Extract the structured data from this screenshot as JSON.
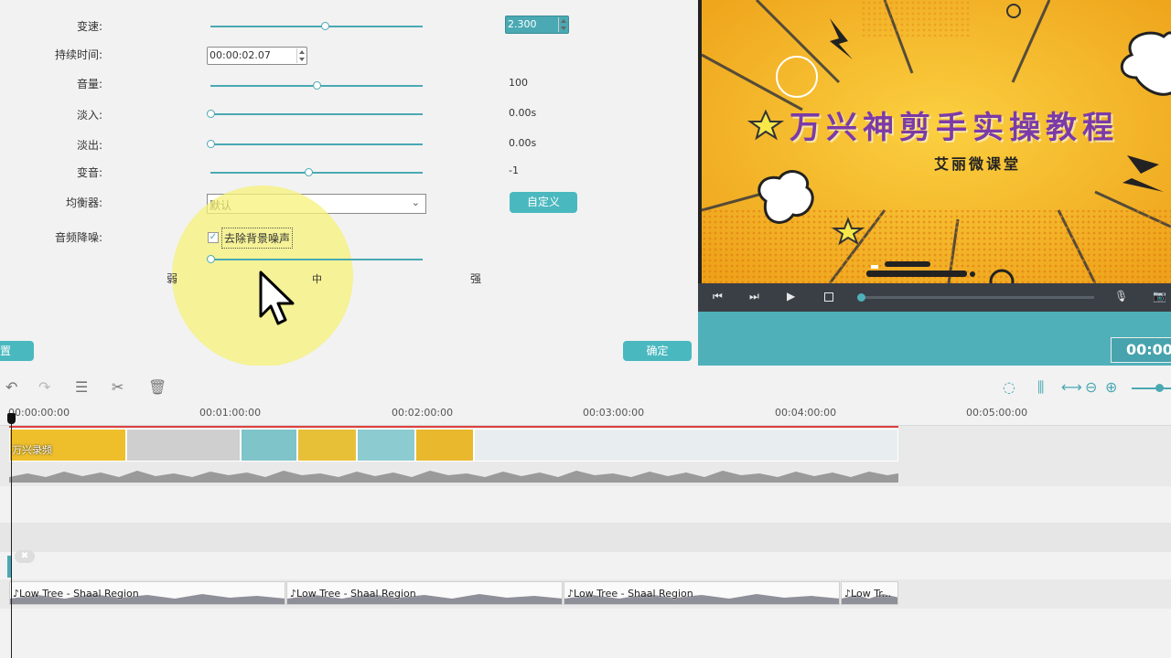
{
  "settings": {
    "speed_label": "变速:",
    "speed_value": "2.300",
    "speed_level": 0.54,
    "duration_label": "持续时间:",
    "duration_value": "00:00:02.07",
    "volume_label": "音量:",
    "volume_value": "100",
    "volume_level": 0.5,
    "fadein_label": "淡入:",
    "fadein_value": "0.00s",
    "fadein_level": 0.0,
    "fadeout_label": "淡出:",
    "fadeout_value": "0.00s",
    "fadeout_level": 0.0,
    "pitch_label": "变音:",
    "pitch_value": "-1",
    "pitch_level": 0.46,
    "equalizer_label": "均衡器:",
    "equalizer_selected": "默认",
    "custom_button": "自定义",
    "denoise_label": "音频降噪:",
    "denoise_checkbox": "去除背景噪声",
    "denoise_checked": true,
    "denoise_level": 0.0,
    "weak_label": "弱",
    "medium_label": "中",
    "strong_label": "强",
    "reset_button": "置",
    "ok_button": "确定"
  },
  "preview": {
    "title": "万兴神剪手实操教程",
    "subtitle": "艾丽微课堂",
    "timecode": "00:00",
    "controls": [
      "prev-frame-icon",
      "next-frame-icon",
      "play-icon",
      "stop-icon",
      "microphone-icon",
      "camera-icon"
    ]
  },
  "timeline": {
    "tools": [
      "undo-icon",
      "redo-icon",
      "adjust-icon",
      "scissors-icon",
      "trash-icon",
      "render-icon",
      "audio-mixer-icon",
      "fit-icon",
      "zoom-out-icon",
      "zoom-in-icon"
    ],
    "ruler_ticks": [
      "00:00:00:00",
      "00:01:00:00",
      "00:02:00:00",
      "00:03:00:00",
      "00:04:00:00",
      "00:05:00:00"
    ],
    "video_clip_label": "万兴录频",
    "audio_clips": [
      "Low Tree - Shaal Region",
      "Low Tree - Shaal Region",
      "Low Tree - Shaal Region",
      "Low Tr..."
    ]
  }
}
